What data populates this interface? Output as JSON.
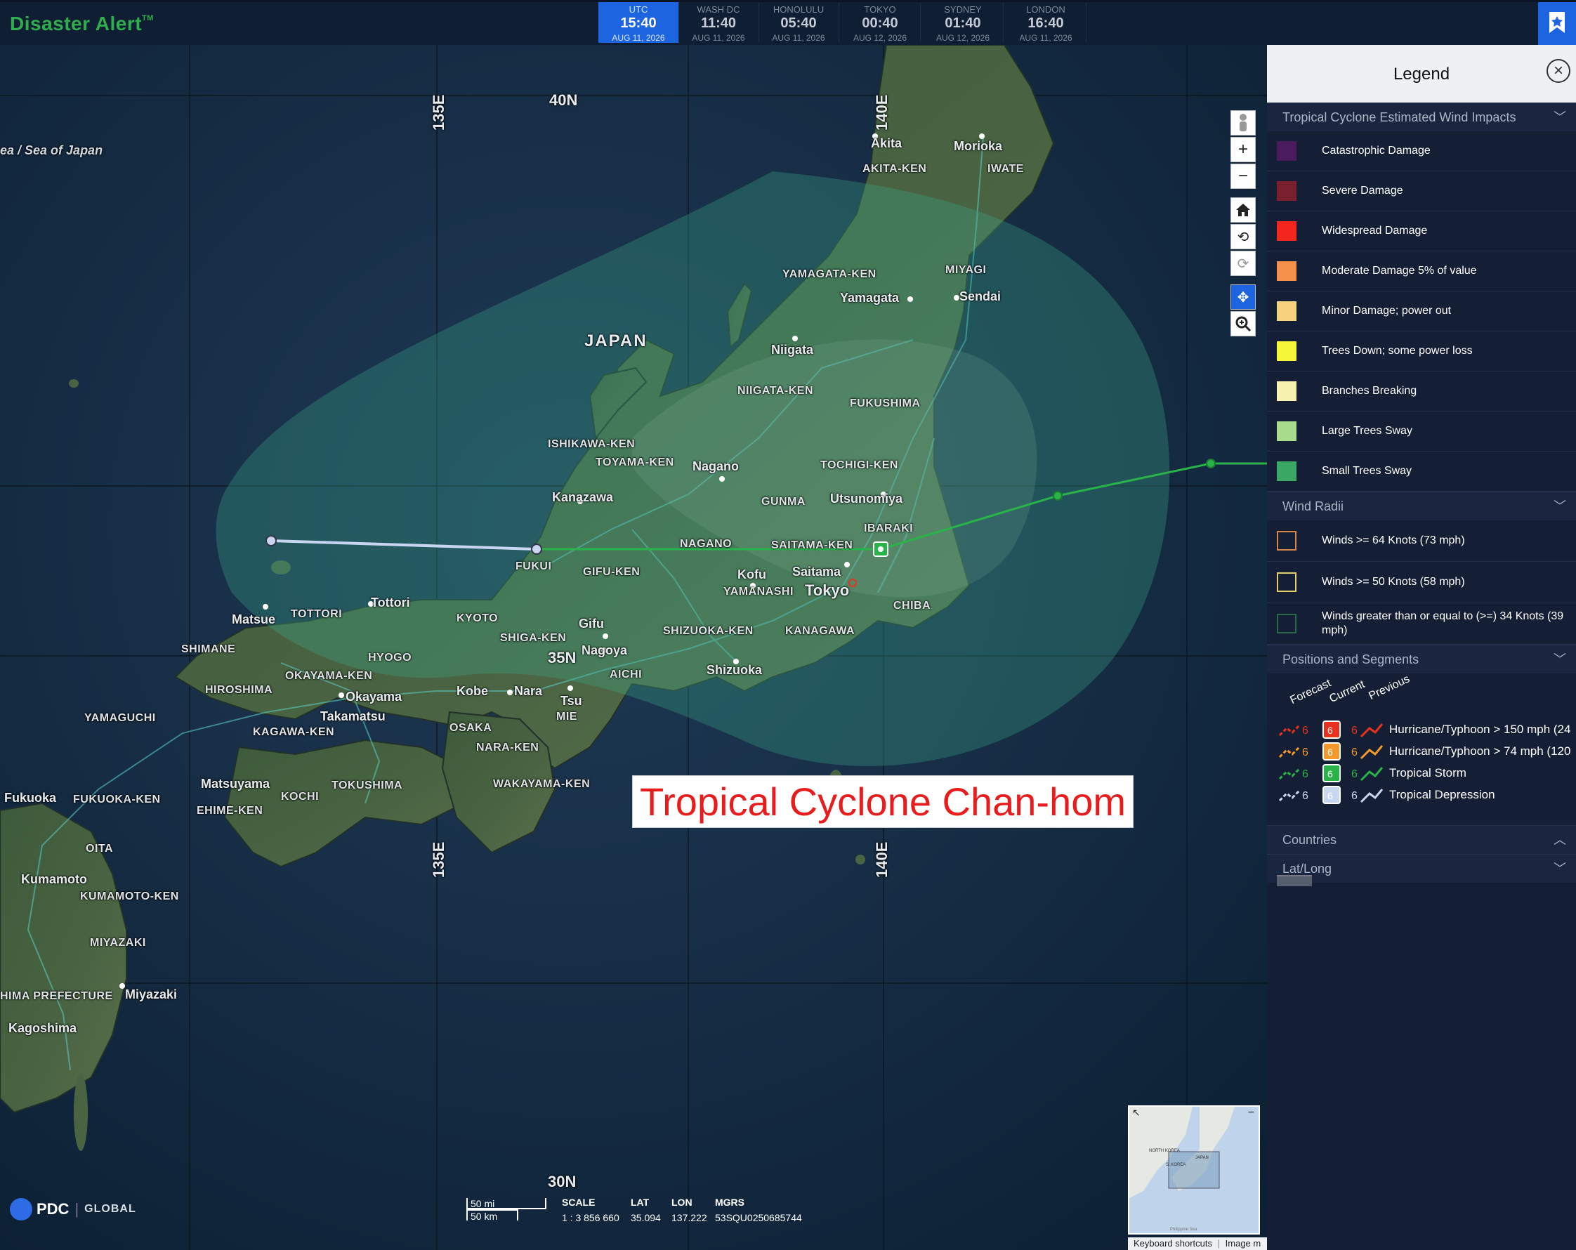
{
  "app": {
    "brand": "Disaster Alert",
    "brand_mark": "TM"
  },
  "clocks": [
    {
      "zone": "UTC",
      "time": "15:40",
      "date": "AUG 11, 2026",
      "active": true
    },
    {
      "zone": "WASH DC",
      "time": "11:40",
      "date": "AUG 11, 2026"
    },
    {
      "zone": "HONOLULU",
      "time": "05:40",
      "date": "AUG 11, 2026"
    },
    {
      "zone": "TOKYO",
      "time": "00:40",
      "date": "AUG 12, 2026"
    },
    {
      "zone": "SYDNEY",
      "time": "01:40",
      "date": "AUG 12, 2026"
    },
    {
      "zone": "LONDON",
      "time": "16:40",
      "date": "AUG 11, 2026"
    }
  ],
  "map": {
    "title_overlay": "Tropical Cyclone Chan-hom",
    "gridlines": {
      "lat_40": "40N",
      "lat_35": "35N",
      "lat_30": "30N",
      "lon_135": "135E",
      "lon_140": "140E"
    },
    "sea_label": "ea / Sea of Japan",
    "country_label": "JAPAN",
    "cities": [
      "Akita",
      "Morioka",
      "Yamagata",
      "Sendai",
      "Niigata",
      "Nagano",
      "Kanazawa",
      "Utsunomiya",
      "Saitama",
      "Kofu",
      "Tokyo",
      "Gifu",
      "Nagoya",
      "Shizuoka",
      "Tsu",
      "Nara",
      "Kobe",
      "Okayama",
      "Takamatsu",
      "Matsue",
      "Tottori",
      "Matsuyama",
      "Fukuoka",
      "Kumamoto",
      "Miyazaki",
      "Kagoshima"
    ],
    "prefectures": [
      "AKITA-KEN",
      "IWATE",
      "YAMAGATA-KEN",
      "MIYAGI",
      "NIIGATA-KEN",
      "FUKUSHIMA",
      "ISHIKAWA-KEN",
      "TOYAMA-KEN",
      "TOCHIGI-KEN",
      "GUNMA",
      "IBARAKI",
      "NAGANO",
      "SAITAMA-KEN",
      "FUKUI",
      "GIFU-KEN",
      "YAMANASHI",
      "CHIBA",
      "KANAGAWA",
      "SHIZUOKA-KEN",
      "AICHI",
      "MIE",
      "KYOTO",
      "SHIGA-KEN",
      "HYOGO",
      "OSAKA",
      "NARA-KEN",
      "WAKAYAMA-KEN",
      "TOTTORI",
      "SHIMANE",
      "OKAYAMA-KEN",
      "HIROSHIMA",
      "YAMAGUCHI",
      "KAGAWA-KEN",
      "TOKUSHIMA",
      "EHIME-KEN",
      "KOCHI",
      "FUKUOKA-KEN",
      "OITA",
      "KUMAMOTO-KEN",
      "MIYAZAKI",
      "HIMA PREFECTURE"
    ]
  },
  "toolbar": {
    "tools": [
      "person-icon",
      "zoom-in-icon",
      "zoom-out-icon",
      "home-icon",
      "rotate-left-icon",
      "rotate-right-icon",
      "pan-icon",
      "zoom-region-icon"
    ]
  },
  "footer": {
    "org": "PDC",
    "org_suffix": "GLOBAL",
    "scale_mi": "50 mi",
    "scale_km": "50 km",
    "scale_label": "SCALE",
    "scale_value": "1 : 3 856 660",
    "lat_label": "LAT",
    "lat_value": "35.094",
    "lon_label": "LON",
    "lon_value": "137.222",
    "mgrs_label": "MGRS",
    "mgrs_value": "53SQU0250685744",
    "keyboard": "Keyboard shortcuts",
    "image_credit": "Image m"
  },
  "legend": {
    "title": "Legend",
    "wind_impacts": {
      "title": "Tropical Cyclone Estimated Wind Impacts",
      "items": [
        {
          "label": "Catastrophic Damage",
          "color": "#4a1c5e"
        },
        {
          "label": "Severe Damage",
          "color": "#7a1f2e"
        },
        {
          "label": "Widespread Damage",
          "color": "#f2261c"
        },
        {
          "label": "Moderate Damage 5% of value",
          "color": "#f5904a"
        },
        {
          "label": "Minor Damage; power out",
          "color": "#f7d27e"
        },
        {
          "label": "Trees Down; some power loss",
          "color": "#f5f53a"
        },
        {
          "label": "Branches Breaking",
          "color": "#f7f2b0"
        },
        {
          "label": "Large Trees Sway",
          "color": "#a8dc8c"
        },
        {
          "label": "Small Trees Sway",
          "color": "#3aa864"
        }
      ]
    },
    "wind_radii": {
      "title": "Wind Radii",
      "items": [
        {
          "label": "Winds >= 64 Knots (73 mph)",
          "color": "#d4854a"
        },
        {
          "label": "Winds >= 50 Knots (58 mph)",
          "color": "#e6cf6a"
        },
        {
          "label": "Winds greater than or equal to (>=) 34 Knots (39 mph)",
          "color": "#2a6a4a"
        }
      ]
    },
    "positions": {
      "title": "Positions and Segments",
      "headers": [
        "Forecast",
        "Current",
        "Previous"
      ],
      "items": [
        {
          "label": "Hurricane/Typhoon > 150 mph (24",
          "color": "#e8321e"
        },
        {
          "label": "Hurricane/Typhoon > 74 mph (120",
          "color": "#f39a2a"
        },
        {
          "label": "Tropical Storm",
          "color": "#29b349"
        },
        {
          "label": "Tropical Depression",
          "color": "#c9d6f2"
        }
      ]
    },
    "countries": {
      "title": "Countries"
    },
    "latlong": {
      "title": "Lat/Long"
    }
  }
}
